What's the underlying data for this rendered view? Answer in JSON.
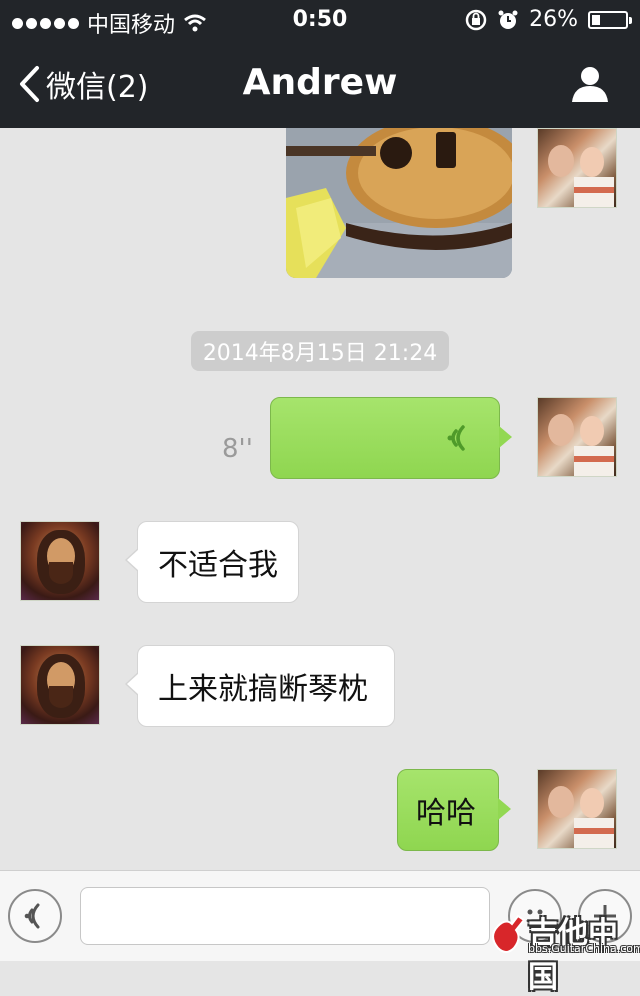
{
  "status_bar": {
    "carrier": "中国移动",
    "time": "0:50",
    "battery_percent_text": "26%",
    "battery_level": 0.26
  },
  "nav": {
    "back_label": "微信(2)",
    "title": "Andrew",
    "contact_icon": "person-icon"
  },
  "chat": {
    "image_message": {
      "description_icon": "photo-guitar"
    },
    "timestamp": "2014年8月15日 21:24",
    "voice_message": {
      "duration": "8''",
      "icon": "voice-wave-icon"
    },
    "messages": [
      {
        "side": "in",
        "text": "不适合我"
      },
      {
        "side": "in",
        "text": "上来就搞断琴枕"
      },
      {
        "side": "out",
        "text": "哈哈"
      }
    ]
  },
  "input_bar": {
    "voice_toggle_icon": "voice-icon",
    "text_value": "",
    "emoji_icon": "emoji-icon",
    "more_icon": "plus-icon"
  },
  "watermark": {
    "brand": "吉他中国",
    "url": "bbs.GuitarChina.com"
  },
  "colors": {
    "bar_bg": "#222529",
    "chat_bg": "#e5e5e5",
    "out_bubble": "#9ee064",
    "in_bubble": "#ffffff"
  }
}
